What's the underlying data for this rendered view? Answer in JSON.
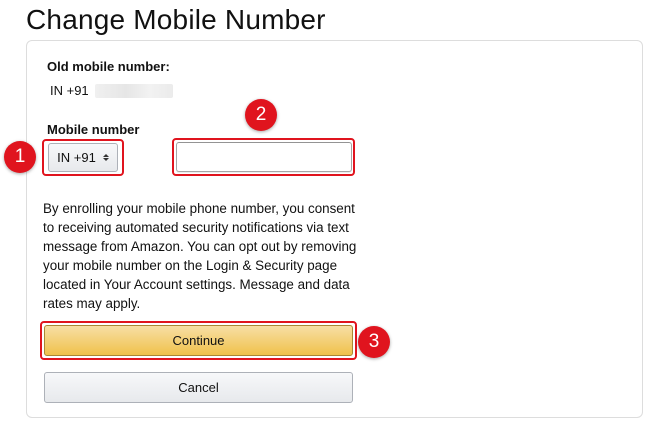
{
  "page": {
    "title": "Change Mobile Number"
  },
  "old_number": {
    "label": "Old mobile number:",
    "prefix": "IN +91"
  },
  "mobile": {
    "label": "Mobile number",
    "country_select": {
      "selected": "IN +91"
    },
    "phone_input": {
      "value": "",
      "placeholder": ""
    }
  },
  "consent_text": "By enrolling your mobile phone number, you consent to receiving automated security notifications via text message from Amazon. You can opt out by removing your mobile number on the Login & Security page located in Your Account settings. Message and data rates may apply.",
  "buttons": {
    "continue_label": "Continue",
    "cancel_label": "Cancel"
  },
  "annotations": {
    "step1": "1",
    "step2": "2",
    "step3": "3"
  },
  "colors": {
    "annotation_red": "#e0141e",
    "continue_button": "#f0c14b",
    "cancel_button": "#e7e9ec",
    "card_border": "#dddddd"
  },
  "icons": {
    "country_select_arrow": "updown-arrows-icon"
  }
}
